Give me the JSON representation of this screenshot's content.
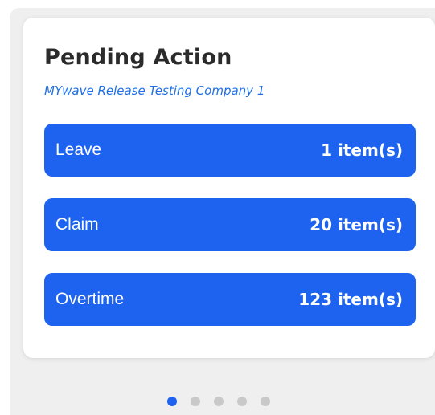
{
  "card": {
    "title": "Pending Action",
    "subtitle": "MYwave Release Testing Company 1"
  },
  "items": [
    {
      "label": "Leave",
      "count": "1 item(s)"
    },
    {
      "label": "Claim",
      "count": "20 item(s)"
    },
    {
      "label": "Overtime",
      "count": "123 item(s)"
    }
  ],
  "pager": {
    "total": 5,
    "active_index": 0
  },
  "colors": {
    "accent": "#1e63ef",
    "subtitle": "#1f6fe6",
    "dot_inactive": "#c9c9c9",
    "background": "#efefef",
    "card": "#ffffff"
  }
}
